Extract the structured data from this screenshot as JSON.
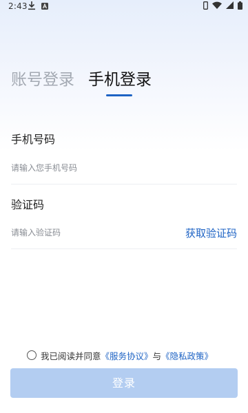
{
  "status_bar": {
    "time": "2:43",
    "icons": [
      "download-icon",
      "a-app-icon",
      "phone-icon",
      "wifi-icon",
      "signal-icon",
      "battery-icon"
    ]
  },
  "tabs": [
    {
      "label": "账号登录",
      "active": false
    },
    {
      "label": "手机登录",
      "active": true
    }
  ],
  "form": {
    "phone_label": "手机号码",
    "phone_placeholder": "请输入您手机号码",
    "code_label": "验证码",
    "code_placeholder": "请输入验证码",
    "get_code": "获取验证码"
  },
  "agreement": {
    "prefix": "我已阅读并同意",
    "service_link": "《服务协议》",
    "conjunction": "与",
    "privacy_link": "《隐私政策》"
  },
  "login_button": "登录",
  "colors": {
    "accent": "#1e63c4",
    "button_disabled": "#b3cdf1",
    "inactive_tab": "#a3a9b2"
  }
}
